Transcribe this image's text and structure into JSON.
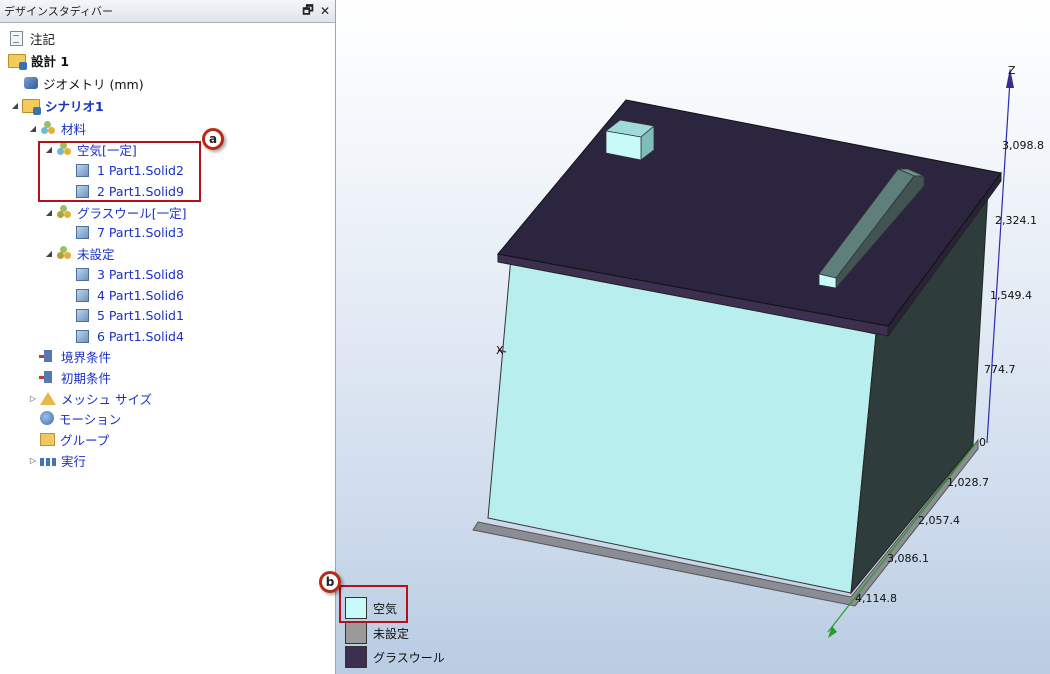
{
  "panel": {
    "title": "デザインスタディバー",
    "float_btn": "🗗",
    "close_btn": "✕"
  },
  "tree": {
    "note": "注記",
    "design": "設計 1",
    "geometry": "ジオメトリ (mm)",
    "scenario": "シナリオ1",
    "materials": "材料",
    "air": "空気[一定]",
    "air_items": [
      "1 Part1.Solid2",
      "2 Part1.Solid9"
    ],
    "glasswool": "グラスウール[一定]",
    "glasswool_items": [
      "7 Part1.Solid3"
    ],
    "unset": "未設定",
    "unset_items": [
      "3 Part1.Solid8",
      "4 Part1.Solid6",
      "5 Part1.Solid1",
      "6 Part1.Solid4"
    ],
    "boundary": "境界条件",
    "initial": "初期条件",
    "mesh": "メッシュ サイズ",
    "motion": "モーション",
    "group": "グループ",
    "run": "実行"
  },
  "callouts": {
    "a": "a",
    "b": "b"
  },
  "axis": {
    "z_label": "Z",
    "x_label": "X",
    "z_ticks": [
      "3,098.8",
      "2,324.1",
      "1,549.4",
      "774.7",
      "0"
    ],
    "y_ticks": [
      "1,028.7",
      "2,057.4",
      "3,086.1",
      "4,114.8"
    ]
  },
  "legend": [
    {
      "label": "空気",
      "color": "#c8fafa"
    },
    {
      "label": "未設定",
      "color": "#9a9a9a"
    },
    {
      "label": "グラスウール",
      "color": "#3c2f4f"
    }
  ],
  "colors": {
    "air": "#b8eeee",
    "lid": "#2b2540",
    "glasswool": "#3c2f4f",
    "side": "#2e3c3c",
    "accent": "#1a30c8",
    "callout": "#b1121c"
  }
}
